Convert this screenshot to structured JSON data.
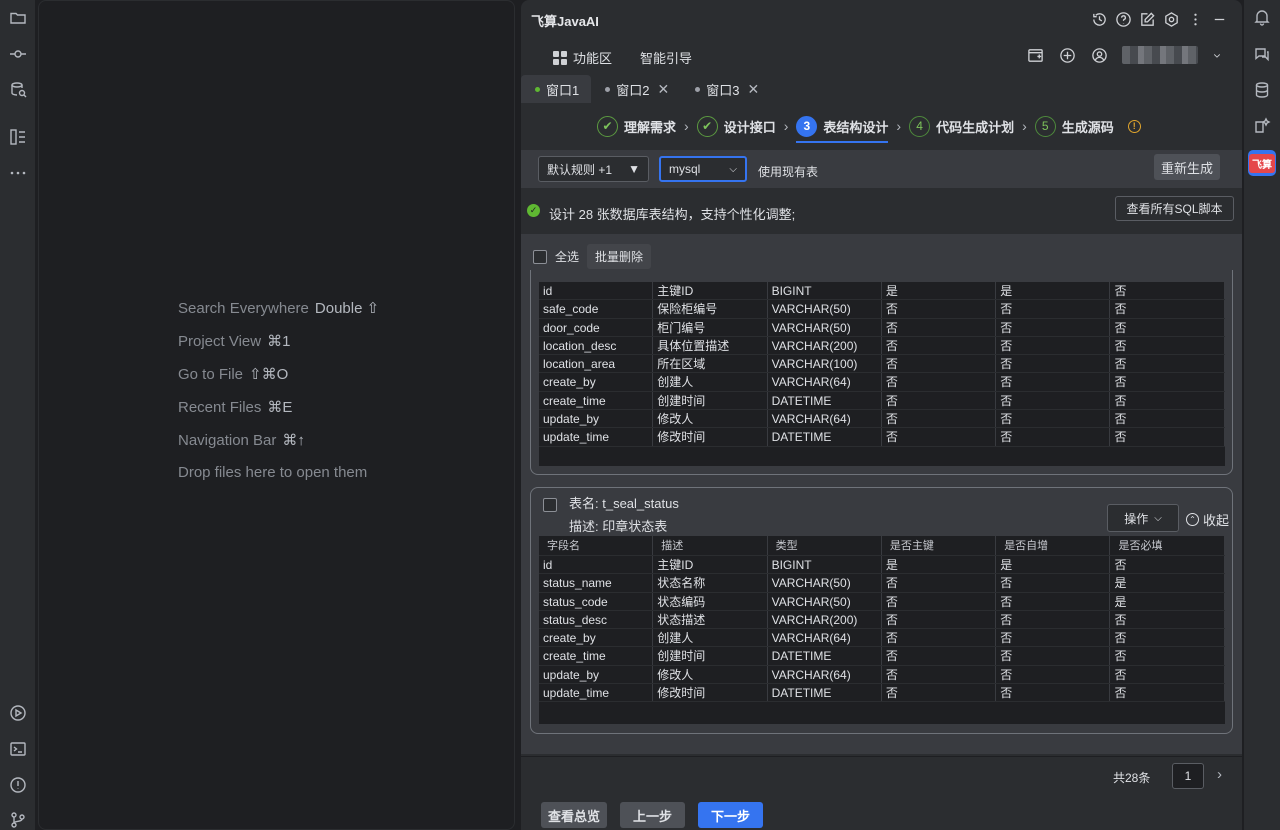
{
  "editor": {
    "hints": [
      {
        "label": "Search Everywhere",
        "key": "Double ⇧"
      },
      {
        "label": "Project View",
        "key": "⌘1"
      },
      {
        "label": "Go to File",
        "key": "⇧⌘O"
      },
      {
        "label": "Recent Files",
        "key": "⌘E"
      },
      {
        "label": "Navigation Bar",
        "key": "⌘↑"
      },
      {
        "label": "Drop files here to open them",
        "key": ""
      }
    ]
  },
  "panel": {
    "title": "飞算JavaAI",
    "nav": {
      "features": "功能区",
      "guide": "智能引导"
    },
    "window_tabs": [
      {
        "label": "窗口1"
      },
      {
        "label": "窗口2"
      },
      {
        "label": "窗口3"
      }
    ],
    "steps": [
      {
        "num": "✔",
        "label": "理解需求"
      },
      {
        "num": "✔",
        "label": "设计接口"
      },
      {
        "num": "3",
        "label": "表结构设计"
      },
      {
        "num": "4",
        "label": "代码生成计划"
      },
      {
        "num": "5",
        "label": "生成源码"
      }
    ],
    "toolbar": {
      "rule_select": "默认规则 +1",
      "db_select": "mysql",
      "use_existing": "使用现有表",
      "regenerate": "重新生成"
    },
    "info": {
      "text": "设计 28 张数据库表结构，支持个性化调整;",
      "view_sql": "查看所有SQL脚本"
    },
    "bulk": {
      "select_all": "全选",
      "batch_delete": "批量删除"
    },
    "columns": [
      "字段名",
      "描述",
      "类型",
      "是否主键",
      "是否自增",
      "是否必填"
    ],
    "table1": {
      "rows": [
        [
          "id",
          "主键ID",
          "BIGINT",
          "是",
          "是",
          "否"
        ],
        [
          "safe_code",
          "保险柜编号",
          "VARCHAR(50)",
          "否",
          "否",
          "否"
        ],
        [
          "door_code",
          "柜门编号",
          "VARCHAR(50)",
          "否",
          "否",
          "否"
        ],
        [
          "location_desc",
          "具体位置描述",
          "VARCHAR(200)",
          "否",
          "否",
          "否"
        ],
        [
          "location_area",
          "所在区域",
          "VARCHAR(100)",
          "否",
          "否",
          "否"
        ],
        [
          "create_by",
          "创建人",
          "VARCHAR(64)",
          "否",
          "否",
          "否"
        ],
        [
          "create_time",
          "创建时间",
          "DATETIME",
          "否",
          "否",
          "否"
        ],
        [
          "update_by",
          "修改人",
          "VARCHAR(64)",
          "否",
          "否",
          "否"
        ],
        [
          "update_time",
          "修改时间",
          "DATETIME",
          "否",
          "否",
          "否"
        ]
      ]
    },
    "table2": {
      "name": "表名: t_seal_status",
      "desc": "描述: 印章状态表",
      "action": "操作",
      "collapse": "收起",
      "rows": [
        [
          "id",
          "主键ID",
          "BIGINT",
          "是",
          "是",
          "否"
        ],
        [
          "status_name",
          "状态名称",
          "VARCHAR(50)",
          "否",
          "否",
          "是"
        ],
        [
          "status_code",
          "状态编码",
          "VARCHAR(50)",
          "否",
          "否",
          "是"
        ],
        [
          "status_desc",
          "状态描述",
          "VARCHAR(200)",
          "否",
          "否",
          "否"
        ],
        [
          "create_by",
          "创建人",
          "VARCHAR(64)",
          "否",
          "否",
          "否"
        ],
        [
          "create_time",
          "创建时间",
          "DATETIME",
          "否",
          "否",
          "否"
        ],
        [
          "update_by",
          "修改人",
          "VARCHAR(64)",
          "否",
          "否",
          "否"
        ],
        [
          "update_time",
          "修改时间",
          "DATETIME",
          "否",
          "否",
          "否"
        ]
      ]
    },
    "pager": {
      "total": "共28条",
      "page": "1"
    },
    "footer": {
      "overview": "查看总览",
      "prev": "上一步",
      "next": "下一步"
    }
  },
  "right_bar": {
    "badge": "飞算"
  },
  "colors": {
    "accent": "#3574f0",
    "success": "#5fb832",
    "warning": "#e0a52d",
    "panel": "#2b2d30"
  }
}
